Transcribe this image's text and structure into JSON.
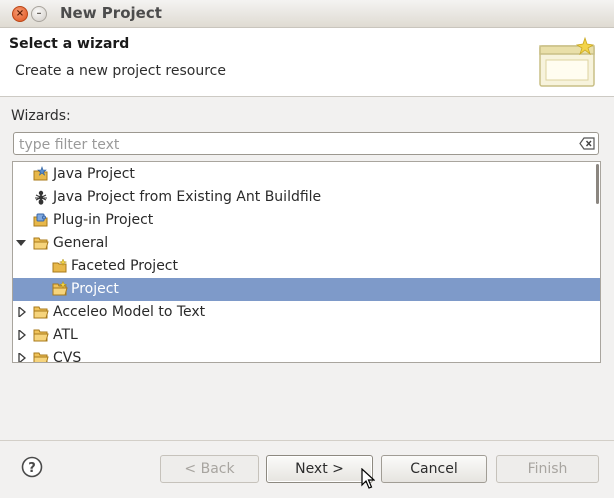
{
  "window": {
    "title": "New Project",
    "close_glyph": "×",
    "min_glyph": "–"
  },
  "header": {
    "title": "Select a wizard",
    "description": "Create a new project resource",
    "graphic_icon": "wizard-banner-icon"
  },
  "wizards": {
    "label": "Wizards:",
    "filter": {
      "value": "",
      "placeholder": "type filter text"
    },
    "items": [
      {
        "label": "Java Project",
        "icon": "java-project-icon",
        "expander": "none",
        "selected": false
      },
      {
        "label": "Java Project from Existing Ant Buildfile",
        "icon": "ant-build-icon",
        "expander": "none",
        "selected": false
      },
      {
        "label": "Plug-in Project",
        "icon": "plugin-project-icon",
        "expander": "none",
        "selected": false
      },
      {
        "label": "General",
        "icon": "folder-icon",
        "expander": "expanded",
        "selected": false
      },
      {
        "label": "Faceted Project",
        "icon": "faceted-project-icon",
        "expander": "none",
        "selected": false
      },
      {
        "label": "Project",
        "icon": "project-folder-icon",
        "expander": "none",
        "selected": true
      },
      {
        "label": "Acceleo Model to Text",
        "icon": "folder-icon",
        "expander": "collapsed",
        "selected": false
      },
      {
        "label": "ATL",
        "icon": "folder-icon",
        "expander": "collapsed",
        "selected": false
      },
      {
        "label": "CVS",
        "icon": "folder-icon",
        "expander": "collapsed",
        "selected": false
      }
    ]
  },
  "buttons": {
    "help_icon": "help-icon",
    "back": "< Back",
    "next": "Next >",
    "cancel": "Cancel",
    "finish": "Finish"
  },
  "colors": {
    "selection": "#7e9ac9",
    "folder": "#e8b84a",
    "close_button": "#e0541f"
  }
}
